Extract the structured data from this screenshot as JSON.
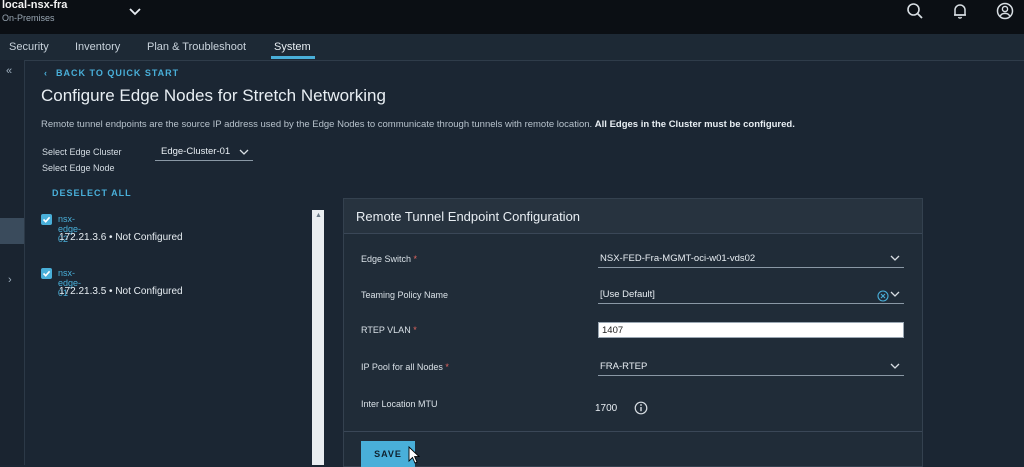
{
  "header": {
    "site_name": "local-nsx-fra",
    "site_type": "On-Premises"
  },
  "tabs": [
    {
      "label": "Security"
    },
    {
      "label": "Inventory"
    },
    {
      "label": "Plan & Troubleshoot"
    },
    {
      "label": "System",
      "active": true
    }
  ],
  "page": {
    "back_link": "BACK TO QUICK START",
    "title": "Configure Edge Nodes for Stretch Networking",
    "description": "Remote tunnel endpoints are the source IP address used by the Edge Nodes to communicate through tunnels with remote location.",
    "description_bold": "All Edges in the Cluster must be configured.",
    "select_cluster_label": "Select Edge Cluster",
    "cluster_value": "Edge-Cluster-01",
    "select_node_label": "Select Edge Node",
    "deselect_all": "DESELECT ALL"
  },
  "nodes": [
    {
      "name": "nsx-edge-02",
      "detail": "172.21.3.6 • Not Configured",
      "checked": true
    },
    {
      "name": "nsx-edge-01",
      "detail": "172.21.3.5 • Not Configured",
      "checked": true
    }
  ],
  "panel": {
    "title": "Remote Tunnel Endpoint Configuration",
    "edge_switch_label": "Edge Switch",
    "edge_switch_value": "NSX-FED-Fra-MGMT-oci-w01-vds02",
    "teaming_label": "Teaming Policy Name",
    "teaming_value": "[Use Default]",
    "rtep_vlan_label": "RTEP VLAN",
    "rtep_vlan_value": "1407",
    "ip_pool_label": "IP Pool for all Nodes",
    "ip_pool_value": "FRA-RTEP",
    "mtu_label": "Inter Location MTU",
    "mtu_value": "1700",
    "required_mark": "*",
    "save_label": "SAVE"
  },
  "colors": {
    "accent": "#49afd9",
    "background": "#1b2633",
    "topbar": "#0b0f14",
    "required": "#e1655f"
  }
}
